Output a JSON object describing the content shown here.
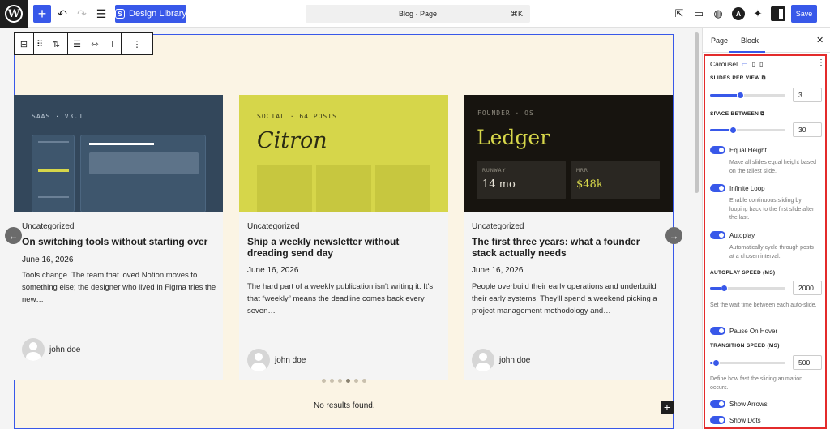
{
  "topbar": {
    "wp_logo_text": "W",
    "add_label": "+",
    "design_library_label": "Design Library",
    "command_label": "Blog · Page",
    "command_shortcut": "⌘K",
    "save_label": "Save"
  },
  "cards": [
    {
      "thumb_caption": "SAAS · V3.1",
      "thumb_bg": "#33475b",
      "category": "Uncategorized",
      "title": "On switching tools without starting over",
      "date": "June 16, 2026",
      "excerpt": "Tools change. The team that loved Notion moves to something else; the designer who lived in Figma tries the new…",
      "author": "john doe"
    },
    {
      "thumb_caption": "SOCIAL · 64 POSTS",
      "thumb_title": "Citron",
      "thumb_bg": "#d6d64a",
      "category": "Uncategorized",
      "title": "Ship a weekly newsletter without dreading send day",
      "date": "June 16, 2026",
      "excerpt": "The hard part of a weekly publication isn't writing it. It's that “weekly” means the deadline comes back every seven…",
      "author": "john doe"
    },
    {
      "thumb_caption": "FOUNDER · OS",
      "thumb_title": "Ledger",
      "thumb_bg": "#17140f",
      "stat1_label": "RUNWAY",
      "stat1_value": "14 mo",
      "stat2_label": "MRR",
      "stat2_value": "$48k",
      "category": "Uncategorized",
      "title": "The first three years: what a founder stack actually needs",
      "date": "June 16, 2026",
      "excerpt": "People overbuild their early operations and underbuild their early systems. They'll spend a weekend picking a project management methodology and…",
      "author": "john doe"
    }
  ],
  "canvas": {
    "no_results": "No results found.",
    "dots_count": 6,
    "active_dot": 3
  },
  "sidebar": {
    "tab_page": "Page",
    "tab_block": "Block",
    "block_name": "Carousel",
    "slides_per_view_label": "SLIDES PER VIEW",
    "slides_per_view": "3",
    "slides_per_view_fraction": 0.4,
    "space_between_label": "SPACE BETWEEN",
    "space_between": "30",
    "space_between_fraction": 0.3,
    "equal_height_label": "Equal Height",
    "equal_height_help": "Make all slides equal height based on the tallest slide.",
    "infinite_loop_label": "Infinite Loop",
    "infinite_loop_help": "Enable continuous sliding by looping back to the first slide after the last.",
    "autoplay_label": "Autoplay",
    "autoplay_help": "Automatically cycle through posts at a chosen interval.",
    "autoplay_speed_label": "AUTOPLAY SPEED (MS)",
    "autoplay_speed": "2000",
    "autoplay_speed_fraction": 0.18,
    "autoplay_speed_help": "Set the wait time between each auto-slide.",
    "pause_on_hover_label": "Pause On Hover",
    "transition_speed_label": "TRANSITION SPEED (MS)",
    "transition_speed": "500",
    "transition_speed_fraction": 0.07,
    "transition_speed_help": "Define how fast the sliding animation occurs.",
    "show_arrows_label": "Show Arrows",
    "show_dots_label": "Show Dots"
  },
  "colors": {
    "accent": "#3858e9",
    "highlight": "#e32b2b",
    "canvas_bg": "#fbf4e4"
  }
}
